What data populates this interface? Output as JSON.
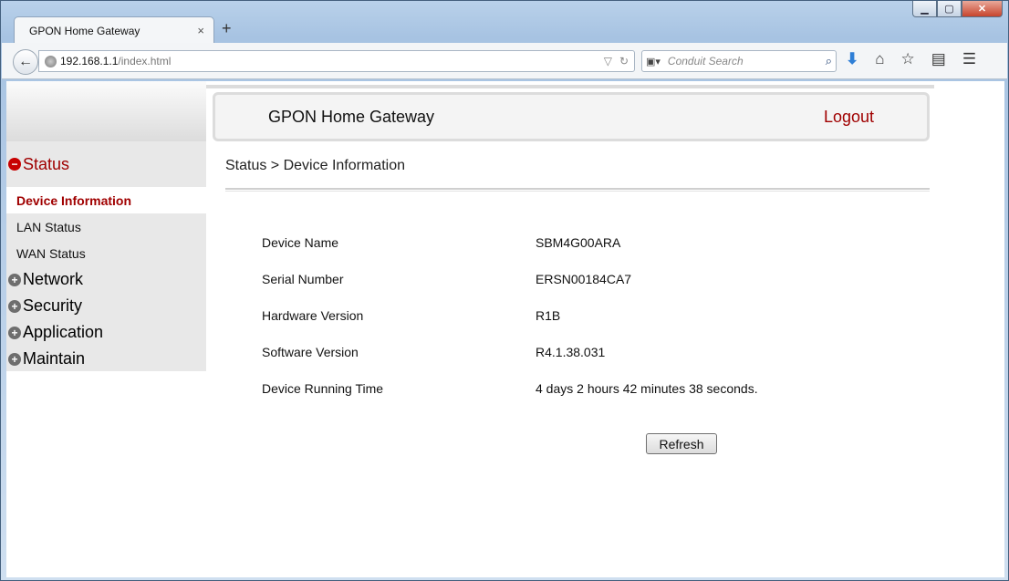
{
  "browser": {
    "tab_title": "GPON Home Gateway",
    "tab_close": "×",
    "new_tab": "+",
    "url_host": "192.168.1.1",
    "url_path": "/index.html",
    "search_placeholder": "Conduit Search",
    "window_controls": {
      "minimize": "▁",
      "maximize": "▢",
      "close": "✕"
    }
  },
  "header": {
    "title": "GPON Home Gateway",
    "logout": "Logout"
  },
  "sidebar": {
    "groups": [
      {
        "label": "Status",
        "open": true,
        "items": [
          "Device Information",
          "LAN Status",
          "WAN Status"
        ]
      },
      {
        "label": "Network",
        "open": false
      },
      {
        "label": "Security",
        "open": false
      },
      {
        "label": "Application",
        "open": false
      },
      {
        "label": "Maintain",
        "open": false
      }
    ],
    "active_item": "Device Information"
  },
  "breadcrumb": "Status > Device Information",
  "device_info": [
    {
      "label": "Device Name",
      "value": "SBM4G00ARA"
    },
    {
      "label": "Serial Number",
      "value": "ERSN00184CA7"
    },
    {
      "label": "Hardware Version",
      "value": "R1B"
    },
    {
      "label": "Software Version",
      "value": "R4.1.38.031"
    },
    {
      "label": "Device Running Time",
      "value": "4 days 2 hours 42 minutes 38 seconds."
    }
  ],
  "refresh_label": "Refresh",
  "colors": {
    "accent": "#a00000",
    "sidebar_bg": "#e8e8e8"
  }
}
